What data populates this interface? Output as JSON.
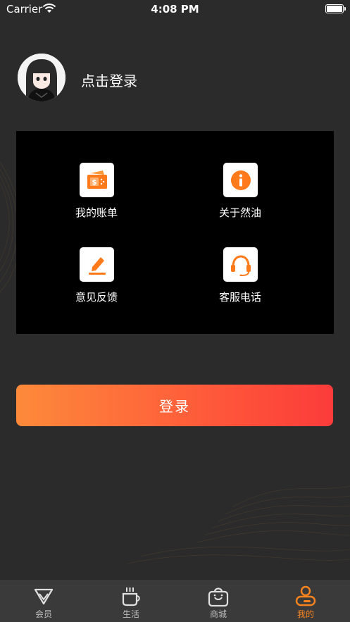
{
  "status_bar": {
    "carrier": "Carrier",
    "time": "4:08 PM"
  },
  "profile": {
    "login_prompt": "点击登录",
    "avatar_icon": "avatar-anime-girl"
  },
  "menu": {
    "items": [
      {
        "label": "我的账单",
        "icon": "bill-icon"
      },
      {
        "label": "关于然油",
        "icon": "info-icon"
      },
      {
        "label": "意见反馈",
        "icon": "feedback-icon"
      },
      {
        "label": "客服电话",
        "icon": "headset-icon"
      }
    ]
  },
  "login_button": {
    "label": "登录"
  },
  "tabs": [
    {
      "label": "会员",
      "icon": "diamond-icon",
      "active": false
    },
    {
      "label": "生活",
      "icon": "coffee-cup-icon",
      "active": false
    },
    {
      "label": "商城",
      "icon": "shopping-bag-icon",
      "active": false
    },
    {
      "label": "我的",
      "icon": "profile-icon",
      "active": true
    }
  ],
  "colors": {
    "background": "#2b2b2b",
    "accent": "#f7831f",
    "button_gradient_start": "#fd8a3a",
    "button_gradient_end": "#fc3b3a",
    "tab_bar": "#3a3a3a"
  }
}
